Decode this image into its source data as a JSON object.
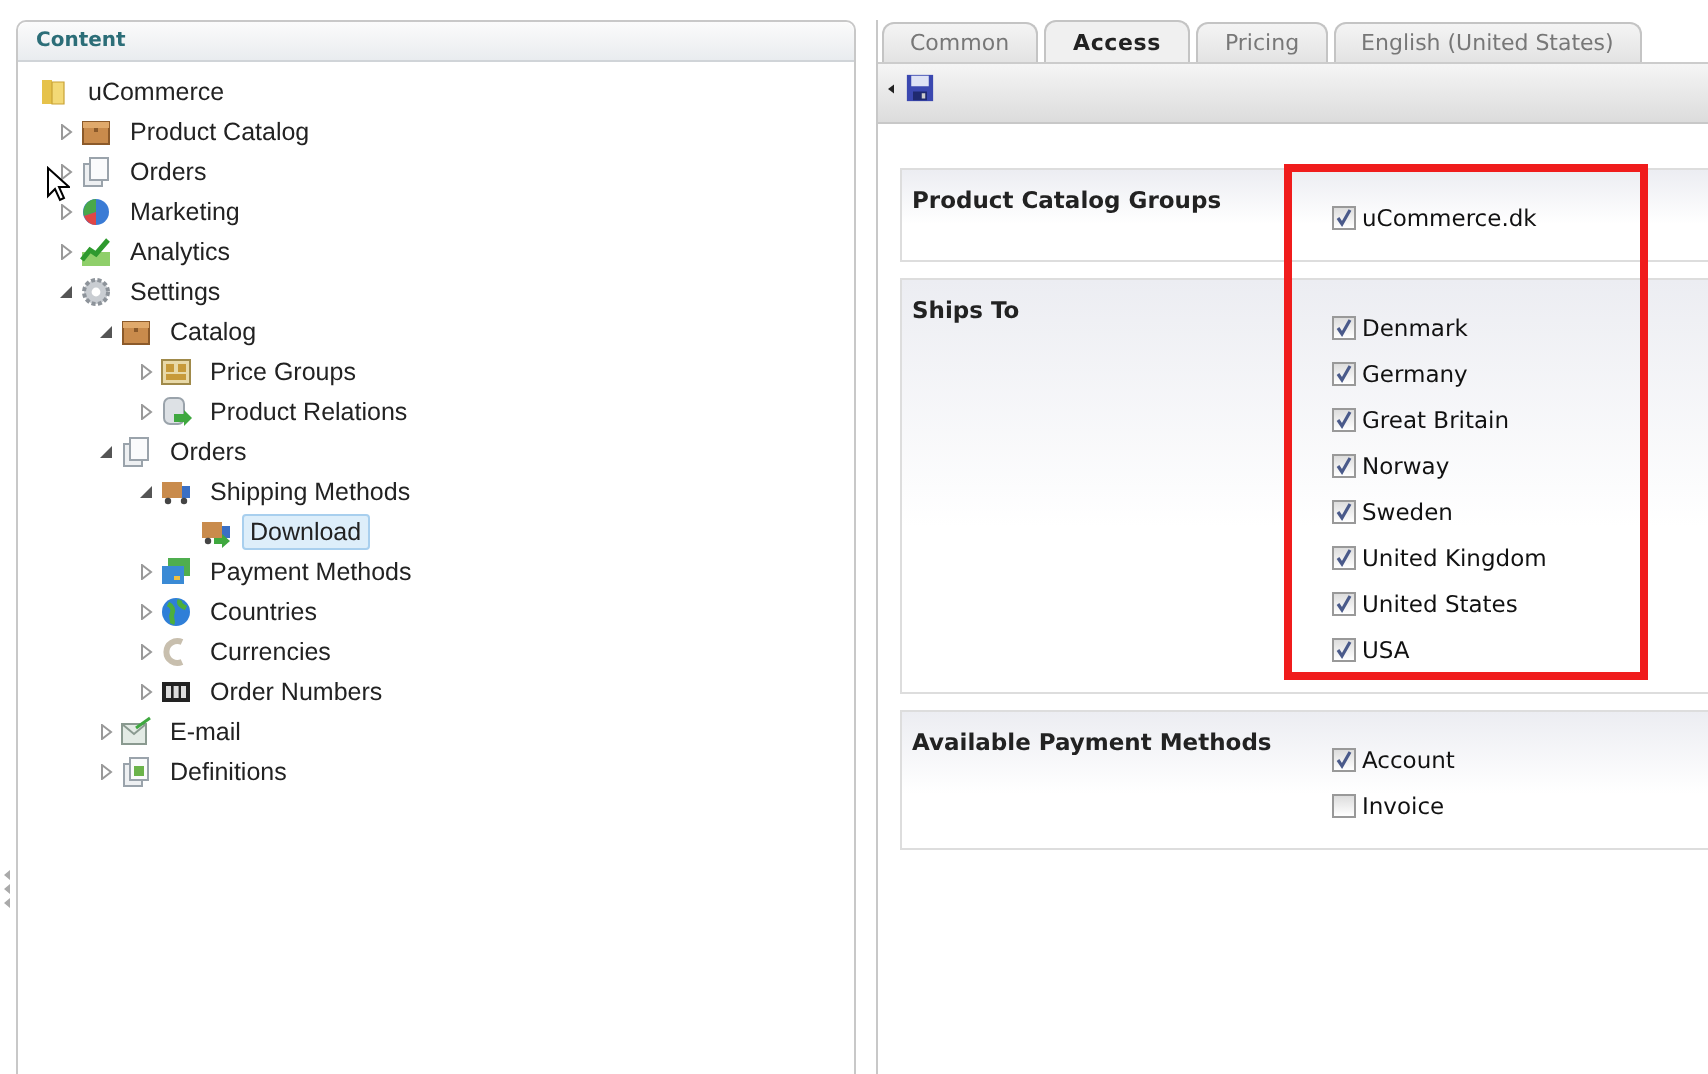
{
  "panel_title": "Content",
  "tree": {
    "label": "uCommerce",
    "kind": "folder",
    "selected": false,
    "children": [
      {
        "label": "Product Catalog",
        "kind": "box",
        "expanded": false,
        "selected": false
      },
      {
        "label": "Orders",
        "kind": "orders",
        "expanded": false,
        "selected": false
      },
      {
        "label": "Marketing",
        "kind": "marketing",
        "expanded": false,
        "selected": false
      },
      {
        "label": "Analytics",
        "kind": "analytics",
        "expanded": false,
        "selected": false
      },
      {
        "label": "Settings",
        "kind": "gear",
        "expanded": true,
        "selected": false,
        "children": [
          {
            "label": "Catalog",
            "kind": "box",
            "expanded": true,
            "selected": false,
            "children": [
              {
                "label": "Price Groups",
                "kind": "price",
                "expanded": false,
                "selected": false
              },
              {
                "label": "Product Relations",
                "kind": "relations",
                "expanded": false,
                "selected": false
              }
            ]
          },
          {
            "label": "Orders",
            "kind": "orders",
            "expanded": true,
            "selected": false,
            "children": [
              {
                "label": "Shipping Methods",
                "kind": "truck",
                "expanded": true,
                "selected": false,
                "children": [
                  {
                    "label": "Download",
                    "kind": "download",
                    "selected": true
                  }
                ]
              },
              {
                "label": "Payment Methods",
                "kind": "payment",
                "expanded": false,
                "selected": false
              },
              {
                "label": "Countries",
                "kind": "globe",
                "expanded": false,
                "selected": false
              },
              {
                "label": "Currencies",
                "kind": "currency",
                "expanded": false,
                "selected": false
              },
              {
                "label": "Order Numbers",
                "kind": "number",
                "expanded": false,
                "selected": false
              }
            ]
          },
          {
            "label": "E-mail",
            "kind": "email",
            "expanded": false,
            "selected": false
          },
          {
            "label": "Definitions",
            "kind": "definitions",
            "expanded": false,
            "selected": false
          }
        ]
      }
    ]
  },
  "tabs": [
    {
      "label": "Common",
      "selected": false
    },
    {
      "label": "Access",
      "selected": true
    },
    {
      "label": "Pricing",
      "selected": false
    },
    {
      "label": "English (United States)",
      "selected": false
    }
  ],
  "sections": [
    {
      "label": "Product Catalog Groups",
      "options": [
        {
          "label": "uCommerce.dk",
          "checked": true
        }
      ]
    },
    {
      "label": "Ships To",
      "options": [
        {
          "label": "Denmark",
          "checked": true
        },
        {
          "label": "Germany",
          "checked": true
        },
        {
          "label": "Great Britain",
          "checked": true
        },
        {
          "label": "Norway",
          "checked": true
        },
        {
          "label": "Sweden",
          "checked": true
        },
        {
          "label": "United Kingdom",
          "checked": true
        },
        {
          "label": "United States",
          "checked": true
        },
        {
          "label": "USA",
          "checked": true
        }
      ]
    },
    {
      "label": "Available Payment Methods",
      "options": [
        {
          "label": "Account",
          "checked": true
        },
        {
          "label": "Invoice",
          "checked": false
        }
      ]
    }
  ]
}
